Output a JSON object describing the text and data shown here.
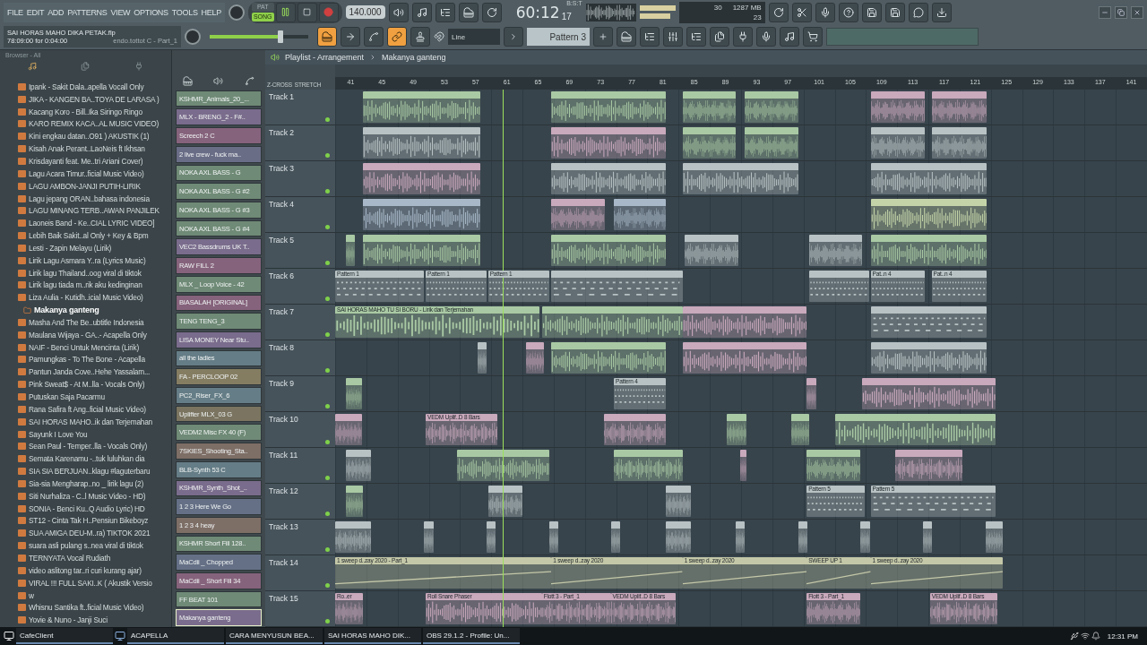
{
  "menu": [
    "FILE",
    "EDIT",
    "ADD",
    "PATTERNS",
    "VIEW",
    "OPTIONS",
    "TOOLS",
    "HELP"
  ],
  "transport": {
    "modes": [
      {
        "label": "PAT",
        "selected": false
      },
      {
        "label": "SONG",
        "selected": true
      }
    ],
    "playing": true,
    "tempo": "140.000"
  },
  "song_time": {
    "value": "60:12",
    "ticks": "17",
    "unit": "B:S:T"
  },
  "cpu": {
    "value": "30",
    "memory": "1287 MB",
    "polyphony": "23"
  },
  "project": {
    "file": "SAI HORAS MAHO DIKA PETAK.flp",
    "selection": "78:09:00 for 0:04:00",
    "hint": "endo.tottot C - Part_1"
  },
  "master_volume": {
    "level": 0.72
  },
  "tools": [
    {
      "on": true
    },
    {
      "on": false
    },
    {
      "on": false
    },
    {
      "on": true
    },
    {
      "on": false
    }
  ],
  "snap": "Line",
  "pattern": "Pattern 3",
  "browser": {
    "title": "Browser - All",
    "items": [
      {
        "label": "Ipank - Sakit Dala..apella Vocall Only",
        "kind": "file",
        "selected": false
      },
      {
        "label": "JIKA - KANGEN BA..TOYA DE LARASA )",
        "kind": "file",
        "selected": false
      },
      {
        "label": "Kacang Koro - Bill..Ika Siringo Ringo",
        "kind": "file",
        "selected": false
      },
      {
        "label": "KARO REMIX KACA..AL MUSIC VIDEO)",
        "kind": "file",
        "selected": false
      },
      {
        "label": "Kini engkau datan..O91 ) AKUSTIK (1)",
        "kind": "file",
        "selected": false
      },
      {
        "label": "Kisah Anak Perant..LaoNeis ft Ikhsan",
        "kind": "file",
        "selected": false
      },
      {
        "label": "Krisdayanti feat. Me..tri Ariani Cover)",
        "kind": "file",
        "selected": false
      },
      {
        "label": "Lagu Acara Timur..ficial Music Video)",
        "kind": "file",
        "selected": false
      },
      {
        "label": "LAGU AMBON-JANJI PUTIH-LIRIK",
        "kind": "file",
        "selected": false
      },
      {
        "label": "Lagu jepang ORAN..bahasa indonesia",
        "kind": "file",
        "selected": false
      },
      {
        "label": "LAGU MINANG TERB..AWAN PANJILEK",
        "kind": "file",
        "selected": false
      },
      {
        "label": "Laoneis Band - Ke..CIAL LYRIC VIDEO]",
        "kind": "file",
        "selected": false
      },
      {
        "label": "Lebih Baik Sakit..al Only + Key & Bpm",
        "kind": "file",
        "selected": false
      },
      {
        "label": "Lesti - Zapin Melayu (Lirik)",
        "kind": "file",
        "selected": false
      },
      {
        "label": "Lirik Lagu Asmara Y..ra (Lyrics Music)",
        "kind": "file",
        "selected": false
      },
      {
        "label": "Lirik lagu Thailand..oog viral di tiktok",
        "kind": "file",
        "selected": false
      },
      {
        "label": "Lirik lagu tiada m..rik aku kedinginan",
        "kind": "file",
        "selected": false
      },
      {
        "label": "Liza Aulia - Kutidh..icial Music Video)",
        "kind": "file",
        "selected": false
      },
      {
        "label": "Makanya ganteng",
        "kind": "project",
        "selected": true
      },
      {
        "label": "Masha And The Be..ubtitle Indonesia",
        "kind": "file",
        "selected": false
      },
      {
        "label": "Maulana Wijaya - GA..- Acapella Only",
        "kind": "file",
        "selected": false
      },
      {
        "label": "NAIF - Benci Untuk Mencinta (Lirik)",
        "kind": "file",
        "selected": false
      },
      {
        "label": "Pamungkas - To The Bone - Acapella",
        "kind": "file",
        "selected": false
      },
      {
        "label": "Pantun Janda Cove..Hehe Yassalam...",
        "kind": "file",
        "selected": false
      },
      {
        "label": "Pink Sweat$ - At M..lla - Vocals Only)",
        "kind": "file",
        "selected": false
      },
      {
        "label": "Putuskan Saja Pacarmu",
        "kind": "file",
        "selected": false
      },
      {
        "label": "Rana Safira ft Ang..ficial Music Video)",
        "kind": "file",
        "selected": false
      },
      {
        "label": "SAI HORAS MAHO..ik dan Terjemahan",
        "kind": "file",
        "selected": false
      },
      {
        "label": "Sayunk I Love You",
        "kind": "file",
        "selected": false
      },
      {
        "label": "Sean Paul - Temper..lla - Vocals Only)",
        "kind": "file",
        "selected": false
      },
      {
        "label": "Semata Karenamu -..tuk luluhkan dia",
        "kind": "file",
        "selected": false
      },
      {
        "label": "SIA SIA BERJUAN..klagu #laguterbaru",
        "kind": "file",
        "selected": false
      },
      {
        "label": "Sia-sia Mengharap..no _ lirik lagu (2)",
        "kind": "file",
        "selected": false
      },
      {
        "label": "Siti Nurhaliza - C..l Music Video - HD)",
        "kind": "file",
        "selected": false
      },
      {
        "label": "SONIA - Benci Ku..Q Audio Lyric) HD",
        "kind": "file",
        "selected": false
      },
      {
        "label": "ST12 - Cinta Tak H..Pensiun Bikeboyz",
        "kind": "file",
        "selected": false
      },
      {
        "label": "SUA AMIGA DEU-M..ra) TIKTOK 2021",
        "kind": "file",
        "selected": false
      },
      {
        "label": "suara asli pulang s..nea viral di tiktok",
        "kind": "file",
        "selected": false
      },
      {
        "label": "TERNYATA Vocal Rudiath",
        "kind": "file",
        "selected": false
      },
      {
        "label": "video aslitong tar..ri curi kurang ajar)",
        "kind": "file",
        "selected": false
      },
      {
        "label": "VIRAL !!! FULL SAKI..K ( Akustik Versio",
        "kind": "file",
        "selected": false
      },
      {
        "label": "w",
        "kind": "file",
        "selected": false
      },
      {
        "label": "Whisnu Santika ft..ficial Music Video)",
        "kind": "file",
        "selected": false
      },
      {
        "label": "Yovie & Nuno - Janji Suci",
        "kind": "file",
        "selected": false
      }
    ]
  },
  "channels": [
    {
      "name": "KSHMR_Animals_20_...",
      "color": "#6f8a76",
      "selected": false
    },
    {
      "name": "MLX - BRENG_2 - F#..",
      "color": "#7a6c8c",
      "selected": false
    },
    {
      "name": "Screech 2 C",
      "color": "#86637c",
      "selected": false
    },
    {
      "name": "2 live crew - fuck ma..",
      "color": "#6a6d86",
      "selected": false
    },
    {
      "name": "NOKA AXL BASS - G",
      "color": "#6f8a76",
      "selected": false
    },
    {
      "name": "NOKA AXL BASS - G #2",
      "color": "#6f8a76",
      "selected": false
    },
    {
      "name": "NOKA AXL BASS - G #3",
      "color": "#6f8a76",
      "selected": false
    },
    {
      "name": "NOKA AXL BASS - G #4",
      "color": "#6f8a76",
      "selected": false
    },
    {
      "name": "VEC2 Bassdrums UK T..",
      "color": "#7a6c8c",
      "selected": false
    },
    {
      "name": "RAW FILL 2",
      "color": "#86637c",
      "selected": false
    },
    {
      "name": "MLX _ Loop Voice - 42",
      "color": "#6f8a76",
      "selected": false
    },
    {
      "name": "BIASALAH [ORIGINAL]",
      "color": "#86637c",
      "selected": false
    },
    {
      "name": "TENG TENG_3",
      "color": "#6f8a76",
      "selected": false
    },
    {
      "name": "LISA MONEY Near Stu..",
      "color": "#7a6c8c",
      "selected": false
    },
    {
      "name": "all the ladies",
      "color": "#657d86",
      "selected": false
    },
    {
      "name": "FA - PERCLOOP 02",
      "color": "#857d62",
      "selected": false
    },
    {
      "name": "PC2_Riser_FX_6",
      "color": "#657d86",
      "selected": false
    },
    {
      "name": "Uplifter MLX_03 G",
      "color": "#7a7460",
      "selected": false
    },
    {
      "name": "VEDM2 Misc FX 40 (F)",
      "color": "#6f8a76",
      "selected": false
    },
    {
      "name": "7SKIES_Shooting_Sta..",
      "color": "#7d6e66",
      "selected": false
    },
    {
      "name": "BLB-Synth 53 C",
      "color": "#657d86",
      "selected": false
    },
    {
      "name": "KSHMR_Synth_Shot_..",
      "color": "#7a6c8c",
      "selected": false
    },
    {
      "name": "1 2 3 Here We Go",
      "color": "#657086",
      "selected": false
    },
    {
      "name": "1 2 3 4 heay",
      "color": "#7d6e66",
      "selected": false
    },
    {
      "name": "KSHMR Short Fill 128..",
      "color": "#6f8a76",
      "selected": false
    },
    {
      "name": "MaCdii _ Chopped",
      "color": "#657086",
      "selected": false
    },
    {
      "name": "MaCdii _ Short Fill 34",
      "color": "#86637c",
      "selected": false
    },
    {
      "name": "FF BEAT 101",
      "color": "#6f8a76",
      "selected": false
    },
    {
      "name": "Makanya ganteng",
      "color": "#7a6c8c",
      "selected": true
    }
  ],
  "playlist": {
    "title": "Playlist - Arrangement",
    "pattern": "Makanya ganteng",
    "options": [
      "Z-CROSS",
      "STRETCH"
    ],
    "ruler": [
      "41",
      "45",
      "49",
      "53",
      "57",
      "61",
      "65",
      "69",
      "73",
      "77",
      "81",
      "85",
      "89",
      "93",
      "97",
      "101",
      "105",
      "109",
      "113",
      "117",
      "121",
      "125",
      "129",
      "133",
      "137",
      "141"
    ],
    "playhead": {
      "level": 0.206
    },
    "tracks": [
      {
        "name": "Track 1",
        "clips": [
          {
            "kind": "audio",
            "color": "#a9c9a4"
          },
          {
            "kind": "audio",
            "color": "#a9c9a4"
          },
          {
            "kind": "audio",
            "color": "#a9c9a4"
          },
          {
            "kind": "audio",
            "color": "#a9c9a4"
          },
          {
            "kind": "audio",
            "color": "#c9a9bc"
          },
          {
            "kind": "audio",
            "color": "#c9a9bc"
          }
        ]
      },
      {
        "name": "Track 2",
        "clips": [
          {
            "kind": "audio",
            "color": "#b8c2c4"
          },
          {
            "kind": "audio",
            "color": "#c9a9bc"
          },
          {
            "kind": "audio",
            "color": "#a9c9a4"
          },
          {
            "kind": "audio",
            "color": "#a9c9a4"
          },
          {
            "kind": "audio",
            "color": "#b8c2c4"
          },
          {
            "kind": "audio",
            "color": "#b8c2c4"
          }
        ]
      },
      {
        "name": "Track 3",
        "clips": [
          {
            "kind": "audio",
            "color": "#c9a9bc"
          },
          {
            "kind": "audio",
            "color": "#b8c2c4"
          },
          {
            "kind": "audio",
            "color": "#b8c2c4"
          },
          {
            "kind": "audio",
            "color": "#b8c2c4"
          }
        ]
      },
      {
        "name": "Track 4",
        "clips": [
          {
            "kind": "audio",
            "color": "#a8b8c8"
          },
          {
            "kind": "audio",
            "color": "#c9a9bc"
          },
          {
            "kind": "audio",
            "color": "#a8b8c8"
          },
          {
            "kind": "audio",
            "color": "#c4d4a8"
          }
        ]
      },
      {
        "name": "Track 5",
        "clips": [
          {
            "kind": "audio",
            "color": "#a9c9a4"
          },
          {
            "kind": "audio",
            "color": "#a9c9a4"
          },
          {
            "kind": "audio",
            "color": "#a9c9a4"
          },
          {
            "kind": "audio",
            "color": "#b8c2c4"
          },
          {
            "kind": "audio",
            "color": "#b8c2c4"
          },
          {
            "kind": "audio",
            "color": "#a9c9a4"
          }
        ]
      },
      {
        "name": "Track 6",
        "clips": [
          {
            "kind": "pattern",
            "color": "#b8c2c4",
            "label": "Pattern 1"
          },
          {
            "kind": "pattern",
            "color": "#b8c2c4",
            "label": "Pattern 1"
          },
          {
            "kind": "pattern",
            "color": "#b8c2c4",
            "label": "Pattern 1"
          },
          {
            "kind": "pattern",
            "color": "#b8c2c4"
          },
          {
            "kind": "pattern",
            "color": "#b8c2c4"
          },
          {
            "kind": "pattern",
            "color": "#b8c2c4",
            "label": "Pat..n 4"
          },
          {
            "kind": "pattern",
            "color": "#b8c2c4",
            "label": "Pat..n 4"
          }
        ]
      },
      {
        "name": "Track 7",
        "clips": [
          {
            "kind": "audio",
            "color": "#a9c9a4",
            "label": "SAI HORAS MAHO TU SI BORU - Lirik dan Terjemahan"
          },
          {
            "kind": "audio",
            "color": "#a9c9a4"
          },
          {
            "kind": "audio",
            "color": "#c9a9bc"
          },
          {
            "kind": "pattern",
            "color": "#b8c2c4"
          }
        ]
      },
      {
        "name": "Track 8",
        "clips": [
          {
            "kind": "audio",
            "color": "#b8c2c4"
          },
          {
            "kind": "audio",
            "color": "#c9a9bc"
          },
          {
            "kind": "audio",
            "color": "#a9c9a4"
          },
          {
            "kind": "audio",
            "color": "#c9a9bc"
          },
          {
            "kind": "audio",
            "color": "#b8c2c4"
          }
        ]
      },
      {
        "name": "Track 9",
        "clips": [
          {
            "kind": "audio",
            "color": "#a9c9a4"
          },
          {
            "kind": "pattern",
            "color": "#b8c2c4",
            "label": "Pattern 4"
          },
          {
            "kind": "audio",
            "color": "#c9a9bc"
          },
          {
            "kind": "audio",
            "color": "#c9a9bc"
          }
        ]
      },
      {
        "name": "Track 10",
        "clips": [
          {
            "kind": "audio",
            "color": "#c9a9bc"
          },
          {
            "kind": "audio",
            "color": "#c9a9bc",
            "label": "VEDM Uplif..D 8 Bars"
          },
          {
            "kind": "audio",
            "color": "#c9a9bc"
          },
          {
            "kind": "audio",
            "color": "#a9c9a4"
          },
          {
            "kind": "audio",
            "color": "#a9c9a4"
          },
          {
            "kind": "audio",
            "color": "#a9c9a4"
          }
        ]
      },
      {
        "name": "Track 11",
        "clips": [
          {
            "kind": "audio",
            "color": "#b8c2c4"
          },
          {
            "kind": "audio",
            "color": "#a9c9a4"
          },
          {
            "kind": "audio",
            "color": "#a9c9a4"
          },
          {
            "kind": "audio",
            "color": "#c9a9bc"
          },
          {
            "kind": "audio",
            "color": "#a9c9a4"
          },
          {
            "kind": "audio",
            "color": "#c9a9bc"
          }
        ]
      },
      {
        "name": "Track 12",
        "clips": [
          {
            "kind": "audio",
            "color": "#a9c9a4"
          },
          {
            "kind": "audio",
            "color": "#b8c2c4"
          },
          {
            "kind": "audio",
            "color": "#b8c2c4"
          },
          {
            "kind": "pattern",
            "color": "#b8c2c4",
            "label": "Pattern 5"
          },
          {
            "kind": "pattern",
            "color": "#b8c2c4",
            "label": "Pattern 5"
          }
        ]
      },
      {
        "name": "Track 13",
        "clips": [
          {
            "kind": "audio",
            "color": "#b8c2c4"
          },
          {
            "kind": "audio",
            "color": "#b8c2c4"
          },
          {
            "kind": "audio",
            "color": "#b8c2c4"
          },
          {
            "kind": "audio",
            "color": "#b8c2c4"
          },
          {
            "kind": "audio",
            "color": "#b8c2c4"
          },
          {
            "kind": "audio",
            "color": "#b8c2c4"
          },
          {
            "kind": "audio",
            "color": "#b8c2c4"
          },
          {
            "kind": "audio",
            "color": "#b8c2c4"
          },
          {
            "kind": "audio",
            "color": "#b8c2c4"
          },
          {
            "kind": "audio",
            "color": "#b8c2c4"
          },
          {
            "kind": "audio",
            "color": "#b8c2c4"
          }
        ]
      },
      {
        "name": "Track 14",
        "clips": [
          {
            "kind": "automation",
            "color": "#c4c8a8",
            "label": "1 sweep d..zay 2020 - Part_1"
          },
          {
            "kind": "automation",
            "color": "#c4c8a8",
            "label": "1 sweep d..zay 2020"
          },
          {
            "kind": "automation",
            "color": "#c4c8a8",
            "label": "1 sweep d..zay 2020"
          },
          {
            "kind": "automation",
            "color": "#c4c8a8",
            "label": "SWEEP UP 1"
          },
          {
            "kind": "automation",
            "color": "#c4c8a8",
            "label": "1 sweep d..zay 2020"
          }
        ]
      },
      {
        "name": "Track 15",
        "clips": [
          {
            "kind": "audio",
            "color": "#c9a9bc",
            "label": "Ro..er"
          },
          {
            "kind": "audio",
            "color": "#c9a9bc",
            "label": "Roll Snare Phaser"
          },
          {
            "kind": "audio",
            "color": "#c9a9bc",
            "label": "Flott 3 - Part_1"
          },
          {
            "kind": "audio",
            "color": "#c9a9bc",
            "label": "VEDM Uplif..D 8 Bars"
          },
          {
            "kind": "audio",
            "color": "#c9a9bc",
            "label": "Flott 3 - Part_1"
          },
          {
            "kind": "audio",
            "color": "#c9a9bc",
            "label": "VEDM Uplif..D 8 Bars"
          }
        ]
      }
    ]
  },
  "taskbar": {
    "items": [
      {
        "label": "CafeClient"
      },
      {
        "label": "ACAPELLA"
      },
      {
        "label": "CARA MENYUSUN BEA..."
      },
      {
        "label": "SAI HORAS MAHO DIK..."
      },
      {
        "label": "OBS 29.1.2 - Profile: Un..."
      }
    ],
    "clock": "12:31 PM"
  }
}
